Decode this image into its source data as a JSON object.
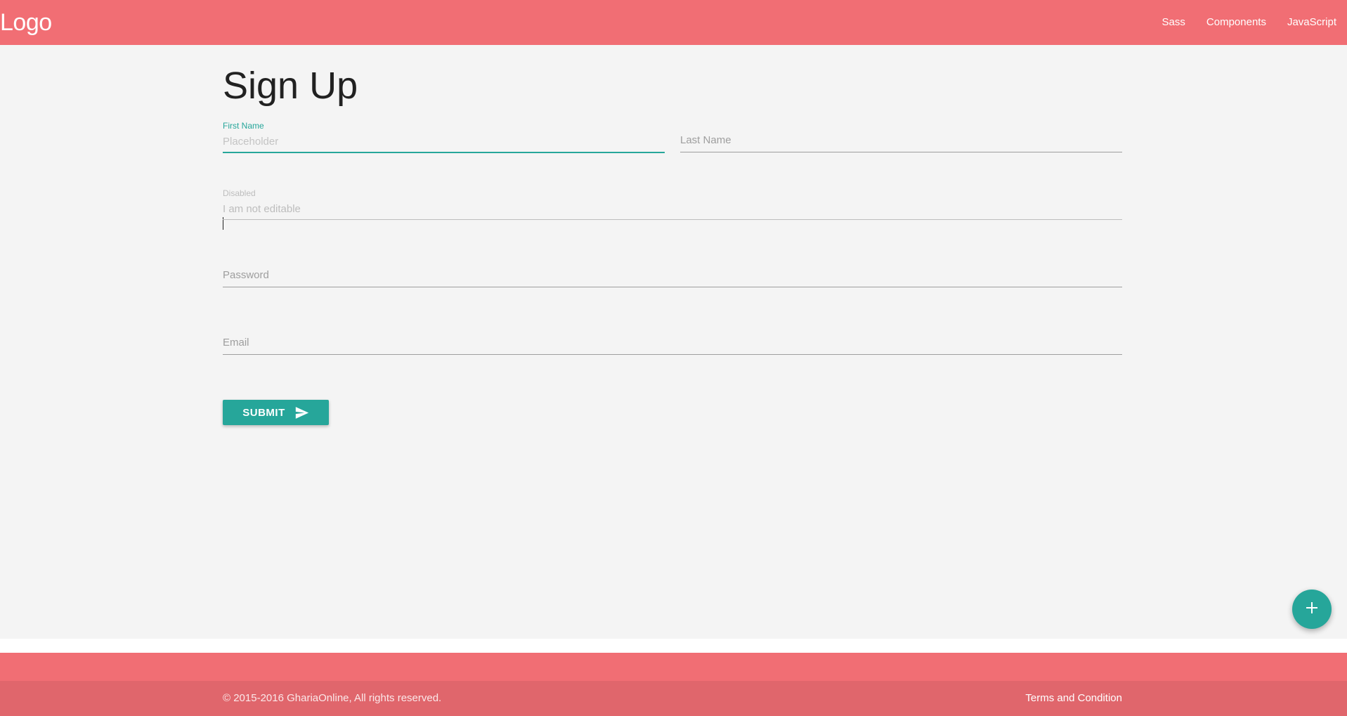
{
  "navbar": {
    "logo": "Logo",
    "links": [
      "Sass",
      "Components",
      "JavaScript"
    ],
    "background_color": "#f16e74"
  },
  "page": {
    "title": "Sign Up"
  },
  "form": {
    "first_name": {
      "label": "First Name",
      "placeholder": "Placeholder",
      "value": ""
    },
    "last_name": {
      "label": "Last Name",
      "value": ""
    },
    "disabled": {
      "label": "Disabled",
      "value": "I am not editable"
    },
    "password": {
      "label": "Password",
      "value": ""
    },
    "email": {
      "label": "Email",
      "value": ""
    },
    "submit": {
      "label": "SUBMIT",
      "icon": "send-icon"
    },
    "accent_color": "#26a69a"
  },
  "fab": {
    "icon": "plus-icon"
  },
  "footer": {
    "copyright": "© 2015-2016 GhariaOnline, All rights reserved.",
    "terms": "Terms and Condition"
  }
}
